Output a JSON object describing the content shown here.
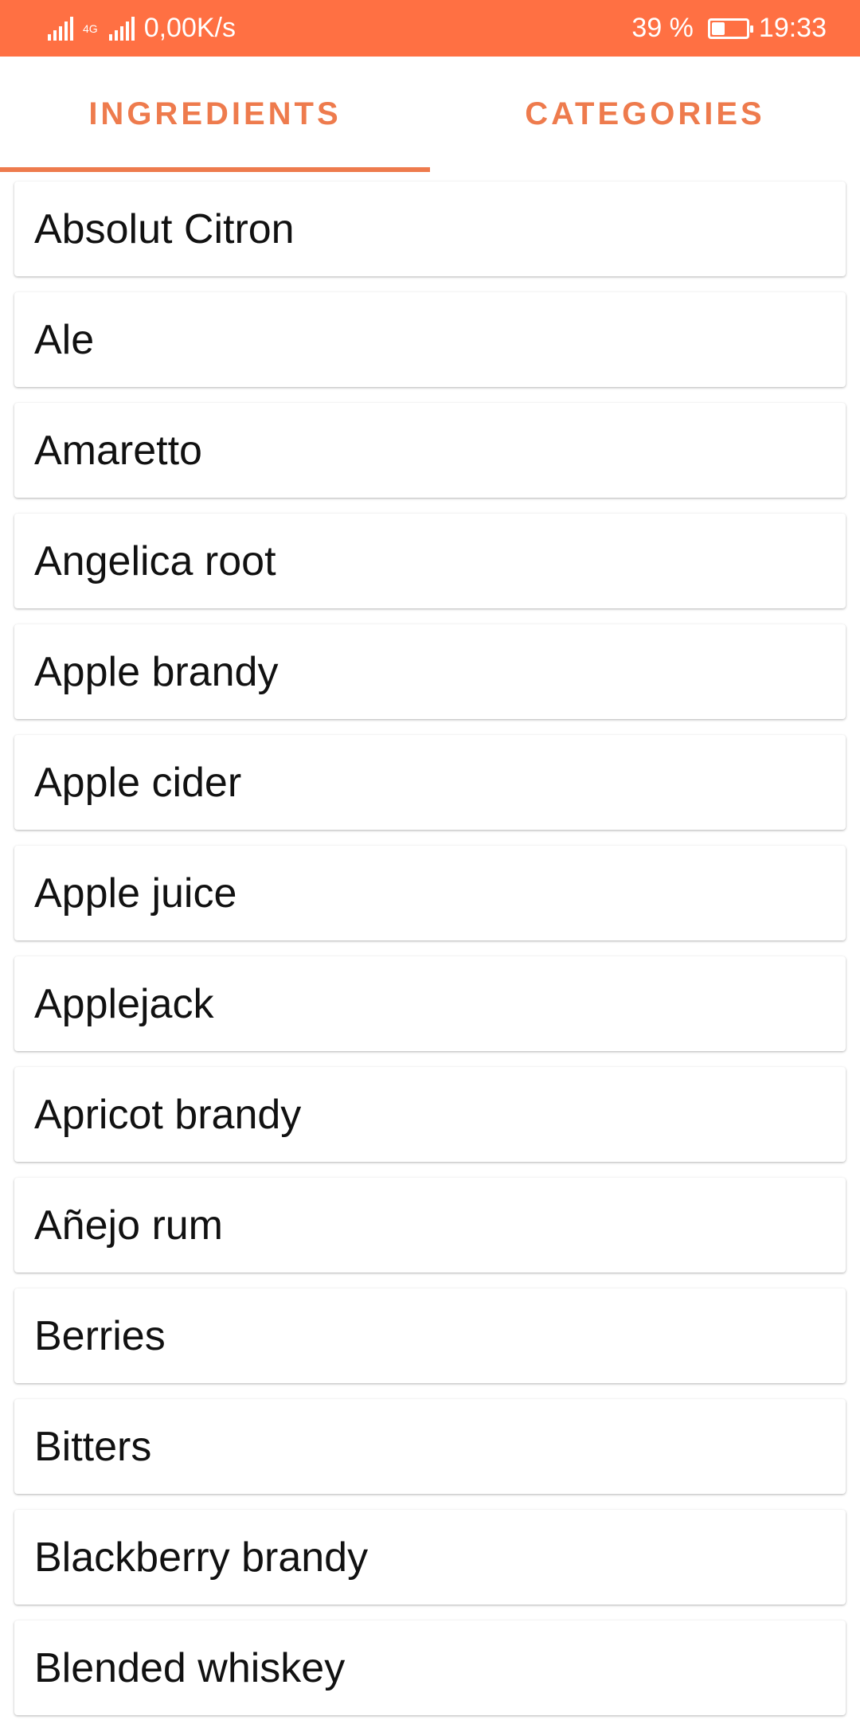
{
  "status_bar": {
    "network_speed": "0,00K/s",
    "network_type": "4G",
    "battery_percent": "39 %",
    "battery_level": 0.39,
    "time": "19:33",
    "background_color": "#FF7043"
  },
  "tabs": [
    {
      "label": "INGREDIENTS",
      "active": true
    },
    {
      "label": "CATEGORIES",
      "active": false
    }
  ],
  "accent_color": "#EE7B4D",
  "ingredients": [
    "Absolut Citron",
    "Ale",
    "Amaretto",
    "Angelica root",
    "Apple brandy",
    "Apple cider",
    "Apple juice",
    "Applejack",
    "Apricot brandy",
    "Añejo rum",
    "Berries",
    "Bitters",
    "Blackberry brandy",
    "Blended whiskey"
  ]
}
